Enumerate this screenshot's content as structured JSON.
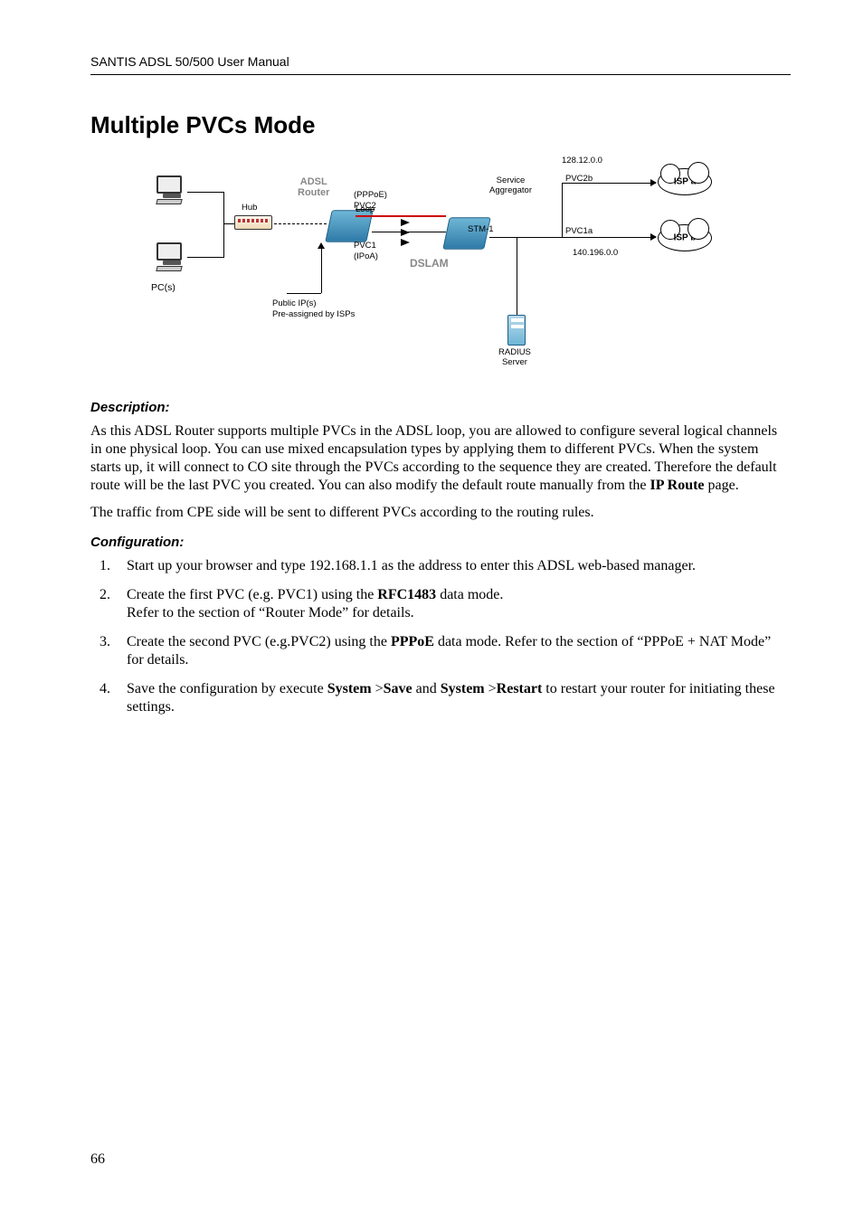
{
  "header": {
    "title": "SANTIS ADSL 50/500 User Manual"
  },
  "section_title": "Multiple PVCs Mode",
  "description_heading": "Description:",
  "description_p1_parts": {
    "pre": "As this ADSL Router supports multiple PVCs in the ADSL loop, you are allowed to configure several logical channels in one physical loop. You can use mixed encapsulation types by applying them to different PVCs. When the system starts up, it will connect to CO site through the PVCs according to the sequence they are created. Therefore the default route will be the last PVC you created. You can also modify the default route manually from the ",
    "bold": "IP Route",
    "post": " page."
  },
  "description_p2": "The traffic from CPE side will be sent to different PVCs according to the routing rules.",
  "configuration_heading": "Configuration:",
  "steps": {
    "s1": "Start up your browser and type 192.168.1.1 as the address to enter this ADSL web-based manager.",
    "s2": {
      "pre": "Create the first PVC (e.g. PVC1) using the ",
      "bold": "RFC1483",
      "mid": " data mode.",
      "line2": "Refer to the section of “Router Mode” for details."
    },
    "s3": {
      "pre": "Create the second PVC (e.g.PVC2) using the ",
      "bold": "PPPoE",
      "post": " data mode. Refer to the section of   “PPPoE + NAT Mode” for details."
    },
    "s4": {
      "pre": "Save the configuration by execute ",
      "b1": "System",
      "g1": " >",
      "b2": "Save",
      "mid": " and ",
      "b3": "System",
      "g2": " >",
      "b4": "Restart",
      "post": " to restart your router for initiating these settings."
    }
  },
  "page_number": "66",
  "diagram": {
    "pcs": "PC(s)",
    "hub": "Hub",
    "adsl_router_l1": "ADSL",
    "adsl_router_l2": "Router",
    "pppoe": "(PPPoE)",
    "pvc2": "PVC2",
    "loop": "Loop",
    "pvc1": "PVC1",
    "ipoa": "(IPoA)",
    "public_ip_l1": "Public IP(s)",
    "public_ip_l2": "Pre-assigned by ISPs",
    "dslam": "DSLAM",
    "stm1": "STM-1",
    "service_agg_l1": "Service",
    "service_agg_l2": "Aggregator",
    "pvc2b": "PVC2b",
    "pvc1a": "PVC1a",
    "radius_l1": "RADIUS",
    "radius_l2": "Server",
    "ip_top": "128.12.0.0",
    "ip_bot": "140.196.0.0",
    "isp_a": "ISP a",
    "isp_b": "ISP b"
  }
}
